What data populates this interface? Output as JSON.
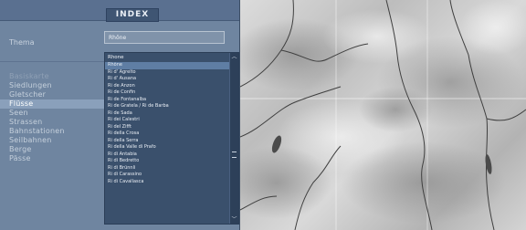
{
  "header": {
    "index_label": "INDEX"
  },
  "theme": {
    "label": "Thema",
    "value": "Rhône"
  },
  "layers": [
    {
      "label": "Basiskarte",
      "state": "dim"
    },
    {
      "label": "Siedlungen",
      "state": "normal"
    },
    {
      "label": "Gletscher",
      "state": "normal"
    },
    {
      "label": "Flüsse",
      "state": "active"
    },
    {
      "label": "Seen",
      "state": "normal"
    },
    {
      "label": "Strassen",
      "state": "normal"
    },
    {
      "label": "Bahnstationen",
      "state": "normal"
    },
    {
      "label": "Seilbahnen",
      "state": "normal"
    },
    {
      "label": "Berge",
      "state": "normal"
    },
    {
      "label": "Pässe",
      "state": "normal"
    }
  ],
  "dropdown": {
    "current": "Rhone",
    "items": [
      "Rhône",
      "Ri d' Agrelto",
      "Ri d' Ausana",
      "Ri de Anzon",
      "Ri de Confin",
      "Ri de Fontanalba",
      "Ri de Gratela / Ri de Barba",
      "Ri de Sada",
      "Ri dei Calestri",
      "Ri del Zifft",
      "Ri della Crosa",
      "Ri della Serra",
      "Ri della Valle di Prafo",
      "Ri di Antabia",
      "Ri di Bedretto",
      "Ri di Brünnli",
      "Ri di Carassino",
      "Ri di Cavallasca"
    ],
    "selected_index": 0,
    "scroll_up_icon": "chevron-up-icon",
    "scroll_down_icon": "chevron-down-icon"
  },
  "map": {
    "type": "shaded-relief"
  }
}
